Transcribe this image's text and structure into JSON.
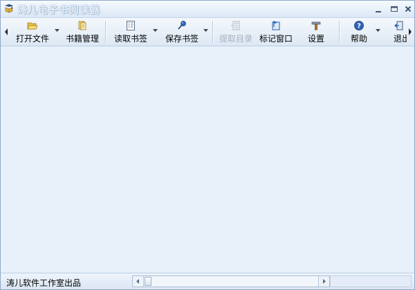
{
  "window": {
    "title": "涛儿电子书阅读器",
    "accent_color": "#dde8f4",
    "controls": {
      "minimize_icon": "minimize-icon",
      "maximize_icon": "maximize-icon",
      "close_icon": "close-icon"
    }
  },
  "toolbar": {
    "buttons": [
      {
        "label": "打开文件",
        "icon": "folder-open-icon",
        "enabled": true,
        "has_dropdown": true
      },
      {
        "label": "书籍管理",
        "icon": "books-icon",
        "enabled": true,
        "has_dropdown": false
      },
      {
        "label": "读取书签",
        "icon": "bookmark-list-icon",
        "enabled": true,
        "has_dropdown": true
      },
      {
        "label": "保存书签",
        "icon": "pin-icon",
        "enabled": true,
        "has_dropdown": true
      },
      {
        "label": "提取目录",
        "icon": "extract-toc-icon",
        "enabled": false,
        "has_dropdown": false
      },
      {
        "label": "标记窗口",
        "icon": "flag-window-icon",
        "enabled": true,
        "has_dropdown": false
      },
      {
        "label": "设置",
        "icon": "tools-icon",
        "enabled": true,
        "has_dropdown": false
      },
      {
        "label": "帮助",
        "icon": "help-icon",
        "enabled": true,
        "has_dropdown": true
      },
      {
        "label": "退出",
        "icon": "exit-icon",
        "enabled": true,
        "has_dropdown": false
      }
    ]
  },
  "statusbar": {
    "text": "涛儿软件工作室出品"
  }
}
